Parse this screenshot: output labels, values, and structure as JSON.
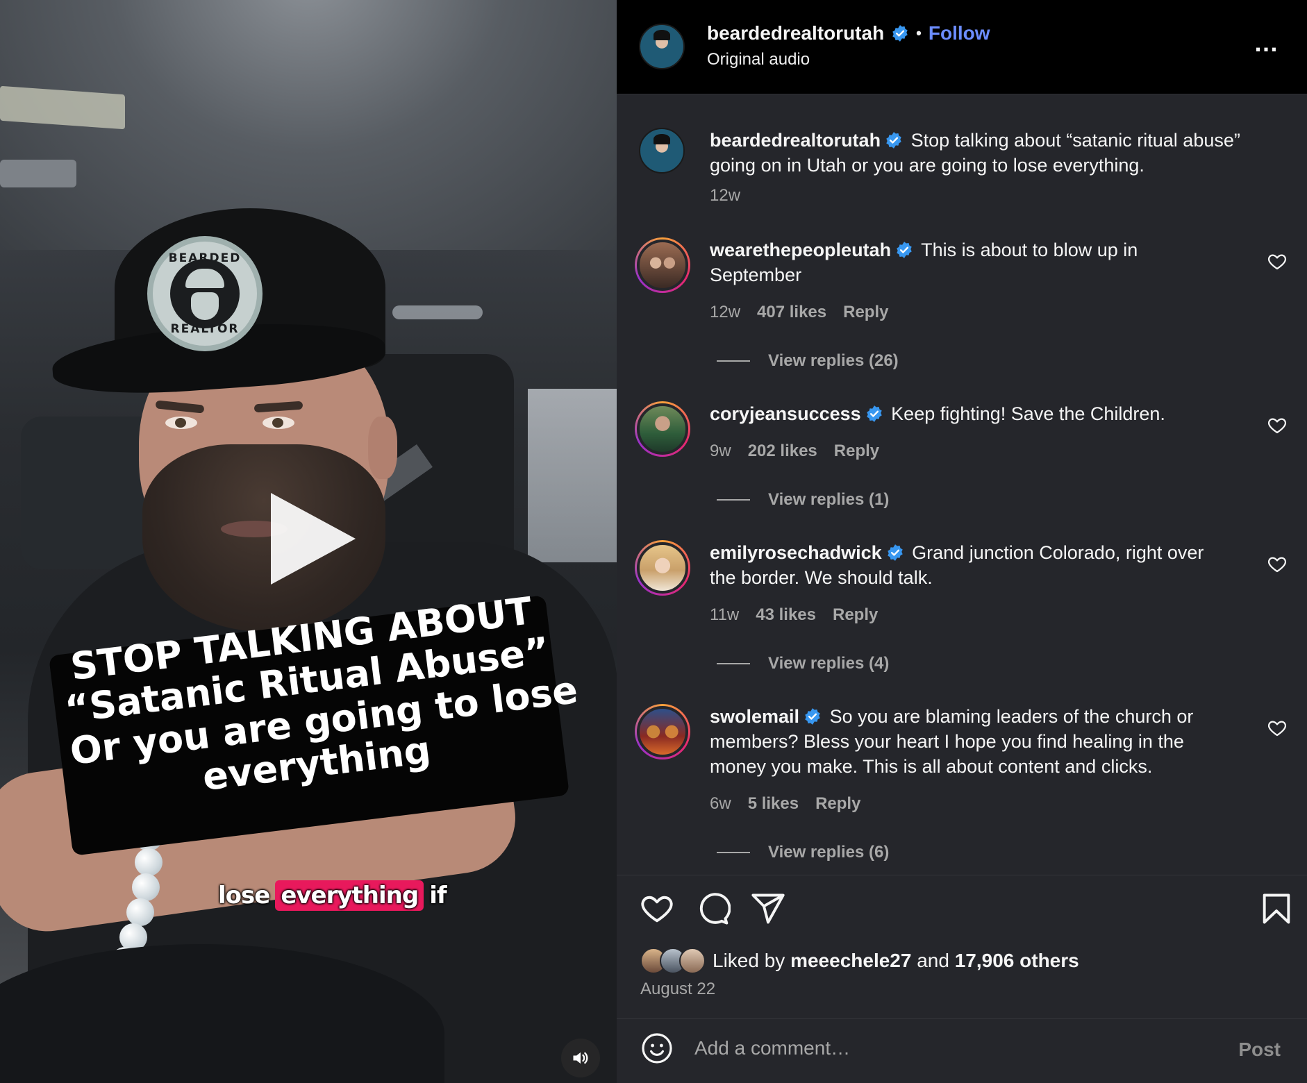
{
  "video": {
    "overlay_lines": [
      "STOP TALKING ABOUT",
      "“Satanic Ritual Abuse”",
      "Or you are going to lose",
      "everything"
    ],
    "caption_words": [
      "lose",
      "everything",
      "if"
    ],
    "cap_logo_top": "BEARDED",
    "cap_logo_bottom": "REALTOR",
    "play_icon": "play-icon",
    "mute_icon": "speaker-icon"
  },
  "header": {
    "username": "beardedrealtorutah",
    "separator": "•",
    "follow_label": "Follow",
    "subtitle": "Original audio",
    "more_label": "…"
  },
  "caption_post": {
    "username": "beardedrealtorutah",
    "text": "Stop talking about “satanic ritual abuse” going on in Utah or you are going to lose everything.",
    "time": "12w"
  },
  "comments": [
    {
      "username": "wearethepeopleutah",
      "text": "This is about to blow up in September",
      "time": "12w",
      "likes": "407 likes",
      "reply_label": "Reply",
      "view_replies": "View replies (26)"
    },
    {
      "username": "coryjeansuccess",
      "text": "Keep fighting! Save the Children.",
      "time": "9w",
      "likes": "202 likes",
      "reply_label": "Reply",
      "view_replies": "View replies (1)"
    },
    {
      "username": "emilyrosechadwick",
      "text": "Grand junction Colorado, right over the border. We should talk.",
      "time": "11w",
      "likes": "43 likes",
      "reply_label": "Reply",
      "view_replies": "View replies (4)"
    },
    {
      "username": "swolemail",
      "text": "So you are blaming leaders of the church or members? Bless your heart I hope you find healing in the money you make. This is all about content and clicks.",
      "time": "6w",
      "likes": "5 likes",
      "reply_label": "Reply",
      "view_replies": "View replies (6)"
    }
  ],
  "actions": {
    "icons": [
      "heart-icon",
      "comment-icon",
      "share-icon",
      "bookmark-icon"
    ],
    "liked_by_prefix": "Liked by",
    "liked_by_user": "meeechele27",
    "liked_by_and": "and",
    "liked_by_others": "17,906 others",
    "date": "August 22"
  },
  "comment_box": {
    "placeholder": "Add a comment…",
    "post_label": "Post"
  },
  "colors": {
    "panel_bg": "#25262b",
    "header_bg": "#000000",
    "follow": "#6c8dff",
    "verified": "#3897f0",
    "muted_text": "#a8a8a8",
    "caption_highlight": "#e8195c"
  }
}
